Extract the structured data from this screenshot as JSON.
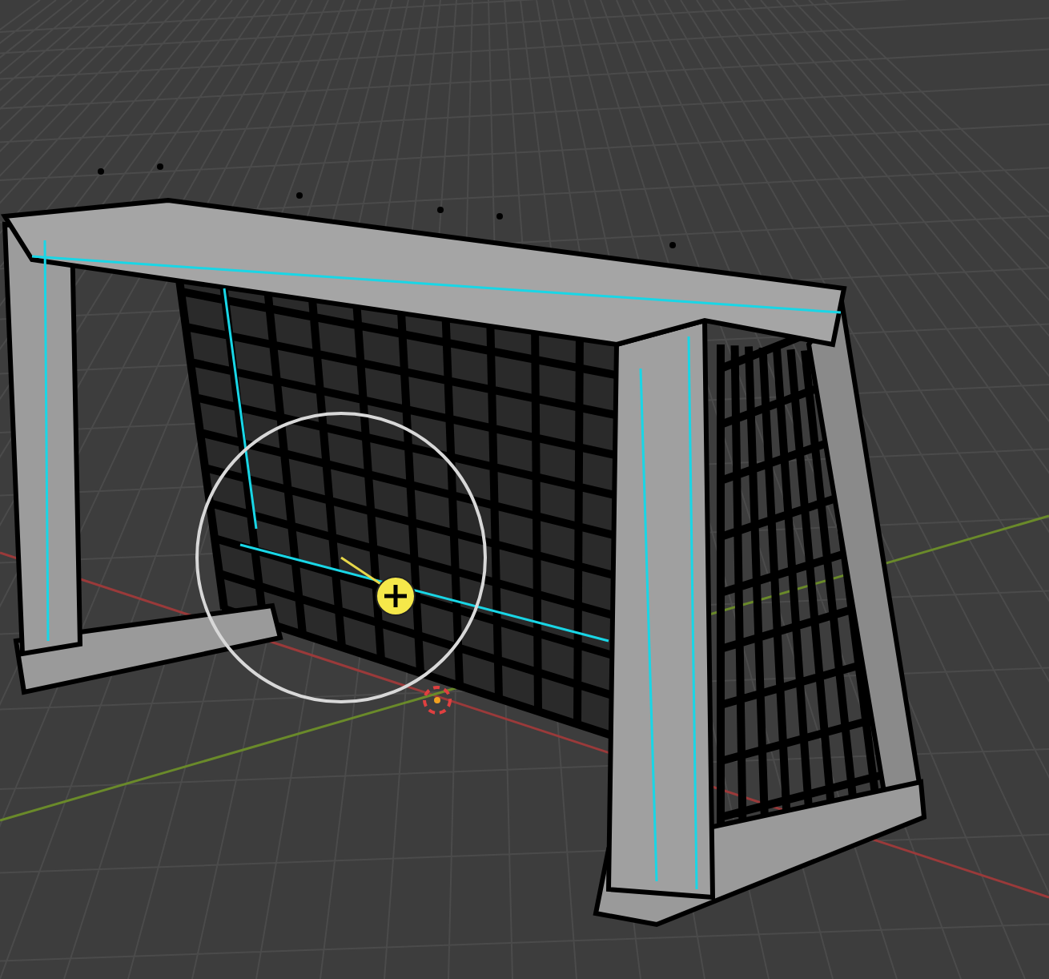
{
  "viewport": {
    "show_grid": true,
    "show_axes": true,
    "show_brush": true
  }
}
